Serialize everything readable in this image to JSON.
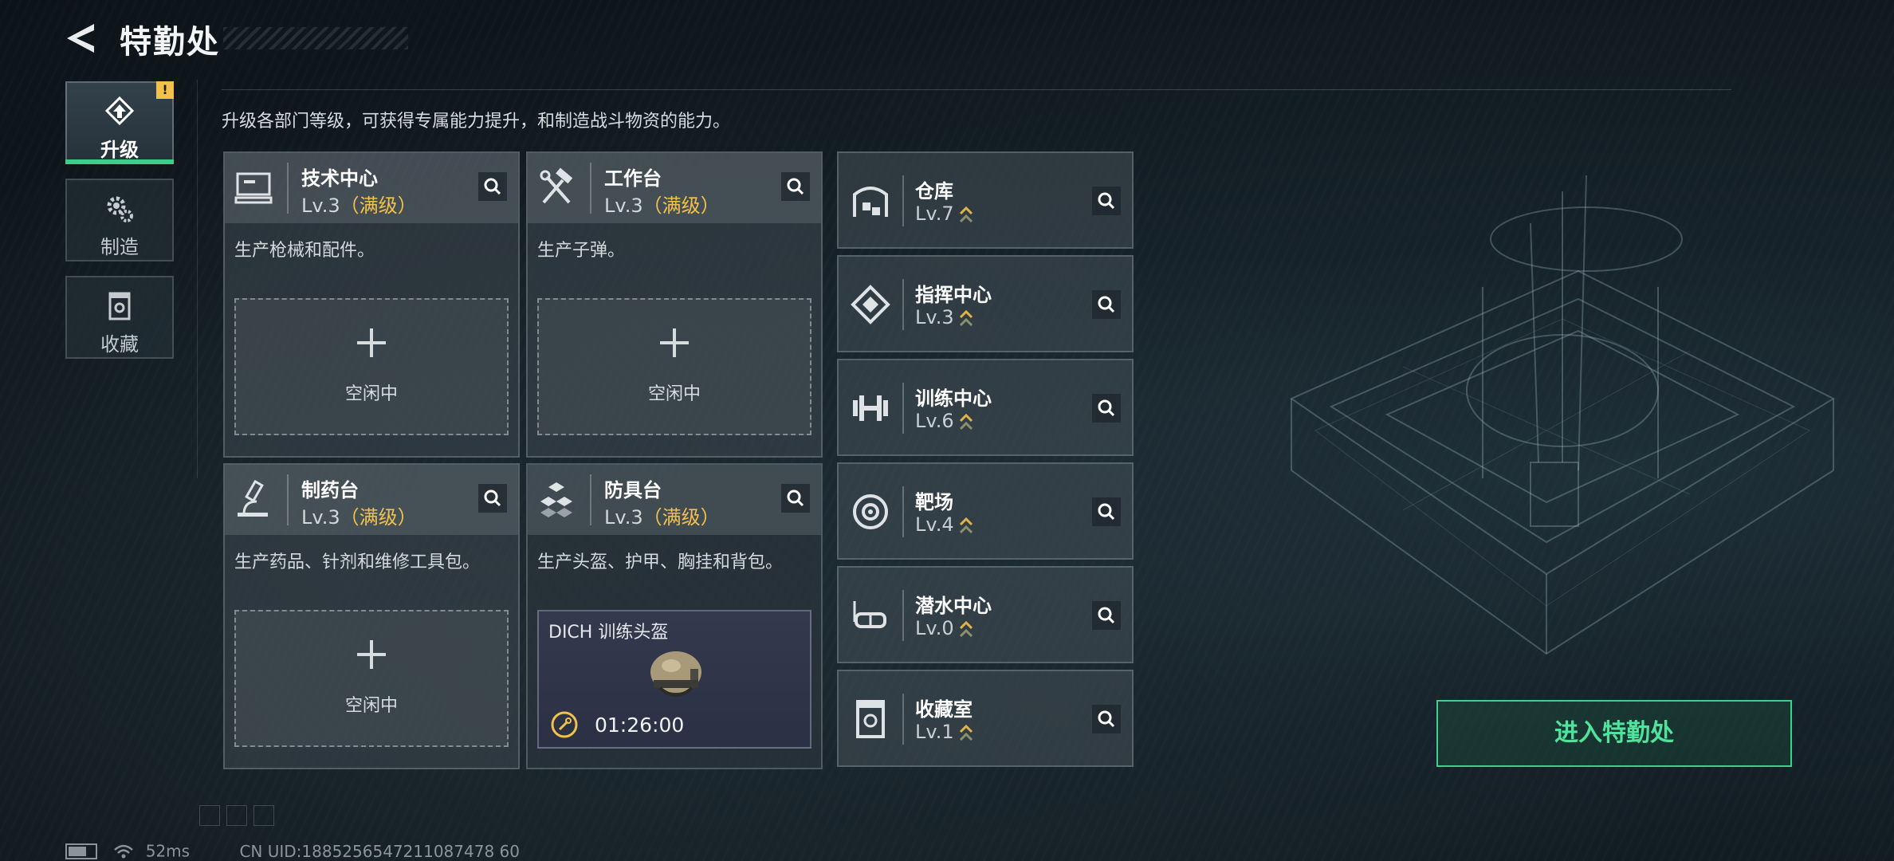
{
  "header": {
    "title": "特勤处",
    "back_icon": "back-arrow-icon"
  },
  "tabs": [
    {
      "label": "升级",
      "icon": "upgrade-icon",
      "active": true,
      "badge": "!"
    },
    {
      "label": "制造",
      "icon": "gear-icon",
      "active": false
    },
    {
      "label": "收藏",
      "icon": "collection-icon",
      "active": false
    }
  ],
  "description": "升级各部门等级，可获得专属能力提升，和制造战斗物资的能力。",
  "main_cards": [
    {
      "name": "技术中心",
      "level": "Lv.3",
      "max": "（满级）",
      "desc": "生产枪械和配件。",
      "slot": "空闲中",
      "icon": "tech-center-icon"
    },
    {
      "name": "工作台",
      "level": "Lv.3",
      "max": "（满级）",
      "desc": "生产子弹。",
      "slot": "空闲中",
      "icon": "hammer-wrench-icon"
    },
    {
      "name": "制药台",
      "level": "Lv.3",
      "max": "（满级）",
      "desc": "生产药品、针剂和维修工具包。",
      "slot": "空闲中",
      "icon": "microscope-icon"
    },
    {
      "name": "防具台",
      "level": "Lv.3",
      "max": "（满级）",
      "desc": "生产头盔、护甲、胸挂和背包。",
      "craft_item": "DICH 训练头盔",
      "craft_time": "01:26:00",
      "icon": "armor-boxes-icon"
    }
  ],
  "side_cards": [
    {
      "name": "仓库",
      "level": "Lv.7",
      "icon": "warehouse-icon"
    },
    {
      "name": "指挥中心",
      "level": "Lv.3",
      "icon": "command-center-icon"
    },
    {
      "name": "训练中心",
      "level": "Lv.6",
      "icon": "dumbbell-icon"
    },
    {
      "name": "靶场",
      "level": "Lv.4",
      "icon": "target-icon"
    },
    {
      "name": "潜水中心",
      "level": "Lv.0",
      "icon": "diving-mask-icon"
    },
    {
      "name": "收藏室",
      "level": "Lv.1",
      "icon": "collection-room-icon"
    }
  ],
  "enter_button": "进入特勤处",
  "footer": {
    "ping": "52ms",
    "uid": "CN UID:1885256547211087478 60"
  },
  "colors": {
    "accent_green": "#3fd08c",
    "max_yellow": "#f2c14b"
  }
}
